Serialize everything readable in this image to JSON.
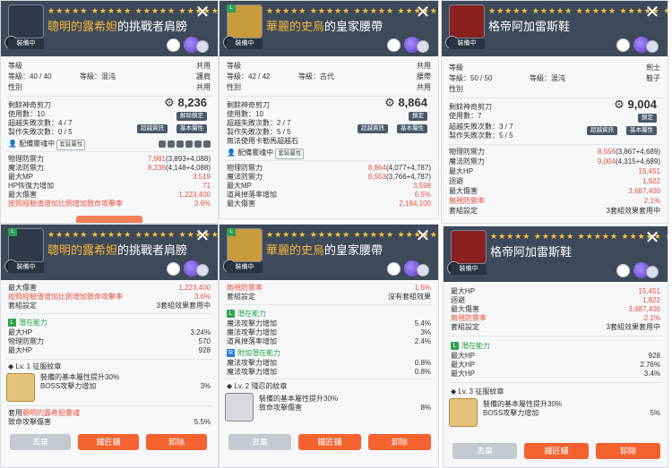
{
  "common": {
    "equip_label": "裝備中",
    "stars": "★★★★★ ★★★★★ ★★★★★ ★★★★★ ★★★★★",
    "close_icon": "✕",
    "level_label": "等級",
    "hammer_label": "剩餘神奇剪刀",
    "locked_label": "解除鎖定",
    "lock_label": "鎖定",
    "detail_btn": "超越資訊",
    "base_attr_btn": "基本屬性",
    "unequip": "丟棄",
    "forge": "鐵匠鋪",
    "remove": "卸除"
  },
  "panels": {
    "p1": {
      "name_hl": "聰明的露希妲",
      "name_rest": "的挑戰者肩膀",
      "level": "等級：40 / 40",
      "grade": "等級：混沌",
      "job": "共用",
      "type": "護肩",
      "attr": "性別",
      "scissors": "剩餘神奇剪刀",
      "use_count": "使用數：10",
      "fail": "超越失敗次數：4 / 7",
      "make_fail": "製作失敗次數：0 / 5",
      "price": "8,236",
      "soul": "配備靈魂中",
      "set_tag": "套裝屬性",
      "stats": [
        {
          "k": "物理防禦力",
          "v": "7,981",
          "x": "(3,893+4,088)"
        },
        {
          "k": "魔法防禦力",
          "v": "8,236",
          "x": "(4,148+4,088)"
        },
        {
          "k": "最大MP",
          "v": "3,519"
        },
        {
          "k": "HP恢復力增加",
          "v": "71"
        },
        {
          "k": "最大傷害",
          "v": "1,223,400"
        },
        {
          "k": "按照經驗值增加比例增加致命攻擊率",
          "v": "3.6%"
        }
      ]
    },
    "p2": {
      "name_hl": "華麗的史烏",
      "name_rest": "的皇家腰帶",
      "level": "等級：42 / 42",
      "grade": "等級：古代",
      "job": "共用",
      "type": "腰帶",
      "attr": "性別",
      "use_count": "使用數：10",
      "fail": "超越失敗次數：2 / 7",
      "make_fail": "製作失敗次數：5 / 5",
      "no_scissor": "無法使用卡勒馬超越石",
      "price": "8,864",
      "soul": "配備靈魂中",
      "set_tag": "套裝屬性",
      "stats": [
        {
          "k": "物理防禦力",
          "v": "8,864",
          "x": "(4,077+4,787)"
        },
        {
          "k": "魔法防禦力",
          "v": "8,553",
          "x": "(3,766+4,787)"
        },
        {
          "k": "最大MP",
          "v": "3,598"
        },
        {
          "k": "道具掉落率增加",
          "v": "6.5%"
        },
        {
          "k": "最大傷害",
          "v": "2,184,100"
        }
      ]
    },
    "p3": {
      "name": "格帝阿加雷斯鞋",
      "level": "等級：50 / 50",
      "grade": "等級：混沌",
      "job": "劍士",
      "type": "鞋子",
      "attr": "性別",
      "use_count": "使用數：7",
      "fail": "超越失敗次數：3 / 7",
      "make_fail": "製作失敗次數：5 / 5",
      "price": "9,004",
      "stats": [
        {
          "k": "物理防禦力",
          "v": "8,556",
          "x": "(3,867+4,689)"
        },
        {
          "k": "魔法防禦力",
          "v": "9,004",
          "x": "(4,315+4,689)"
        },
        {
          "k": "最大HP",
          "v": "15,451"
        },
        {
          "k": "迴避",
          "v": "1,822"
        },
        {
          "k": "最大傷害",
          "v": "3,687,400"
        },
        {
          "k": "無視防禦率",
          "v": "2.1%"
        },
        {
          "k": "套組設定",
          "v": "3套組效果套用中"
        }
      ]
    },
    "p4": {
      "name_hl": "聰明的露希妲",
      "name_rest": "的挑戰者肩膀",
      "rows": [
        {
          "k": "最大傷害",
          "v": "1,223,400"
        },
        {
          "k": "按照經驗值增加比例增加致命攻擊率",
          "v": "3.6%"
        },
        {
          "k": "套組設定",
          "v": "3套組效果套用中"
        }
      ],
      "pot_title": "潛在能力",
      "pot": [
        {
          "k": "最大HP",
          "v": "3.24%"
        },
        {
          "k": "物理防禦力",
          "v": "570"
        },
        {
          "k": "最大HP",
          "v": "928"
        }
      ],
      "emblem_title": "Lv. 1 征服紋章",
      "emblem_desc": "裝備的基本屬性提升30%",
      "emblem_stat": "BOSS攻擊力增加",
      "emblem_val": "3%",
      "set_line_a": "套用",
      "set_line_b": "聰明的露希妲靈魂",
      "set_stat": "致命攻擊傷害",
      "set_val": "5.5%"
    },
    "p5": {
      "name_hl": "華麗的史烏",
      "name_rest": "的皇家腰帶",
      "rows": [
        {
          "k": "無視防禦率",
          "v": "1.5%"
        },
        {
          "k": "套組設定",
          "v": "沒有套組效果"
        }
      ],
      "pot_title": "潛在能力",
      "pot": [
        {
          "k": "魔法攻擊力增加",
          "v": "5.4%"
        },
        {
          "k": "魔法攻擊力增加",
          "v": "3%"
        },
        {
          "k": "道具掉落率增加",
          "v": "2.4%"
        }
      ],
      "add_pot_title": "附加潛在能力",
      "add_pot": [
        {
          "k": "魔法攻擊力增加",
          "v": "0.8%"
        },
        {
          "k": "魔法攻擊力增加",
          "v": "0.8%"
        }
      ],
      "emblem_title": "Lv. 2 殘忍的紋章",
      "emblem_desc": "裝備的基本屬性提升30%",
      "emblem_stat": "致命攻擊傷害",
      "emblem_val": "8%"
    },
    "p6": {
      "name": "格帝阿加雷斯鞋",
      "rows": [
        {
          "k": "最大HP",
          "v": "15,451"
        },
        {
          "k": "迴避",
          "v": "1,822"
        },
        {
          "k": "最大傷害",
          "v": "3,687,400"
        },
        {
          "k": "無視防禦率",
          "v": "2.1%"
        },
        {
          "k": "套組設定",
          "v": "3套組效果套用中"
        }
      ],
      "pot_title": "潛在能力",
      "pot": [
        {
          "k": "最大HP",
          "v": "928"
        },
        {
          "k": "最大HP",
          "v": "2.76%"
        },
        {
          "k": "最大HP",
          "v": "3.4%"
        }
      ],
      "emblem_title": "Lv. 3 征服紋章",
      "emblem_desc": "裝備的基本屬性提升30%",
      "emblem_stat": "BOSS攻擊力增加",
      "emblem_val": "5%"
    }
  }
}
